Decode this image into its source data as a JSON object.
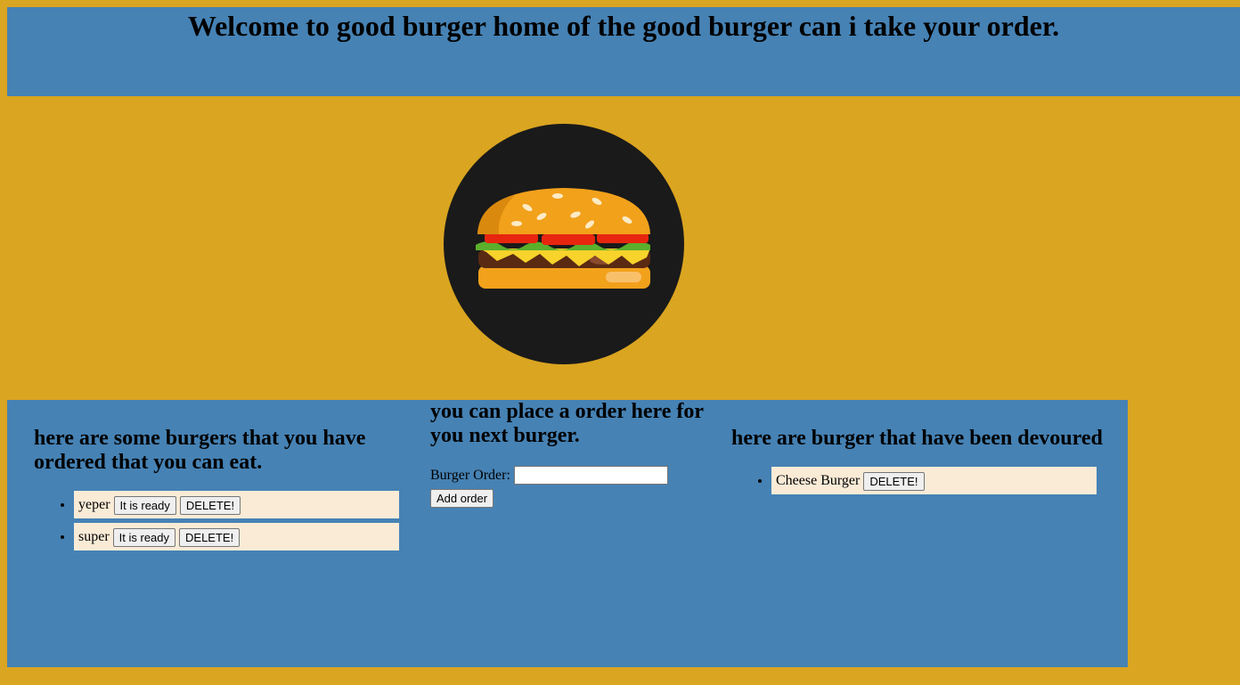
{
  "header": {
    "title": "Welcome to good burger home of the good burger can i take your order."
  },
  "logo": {
    "icon": "burger-icon",
    "colors": {
      "circle": "#1a1a1a",
      "bun": "#F2A11B",
      "tomato": "#E8260F",
      "lettuce": "#5BAF2A",
      "cheese": "#F7D32B",
      "patty": "#5A2A12"
    }
  },
  "ordered": {
    "heading": "here are some burgers that you have ordered that you can eat.",
    "items": [
      {
        "name": "yeper",
        "ready_label": "It is ready",
        "delete_label": "DELETE!"
      },
      {
        "name": "super",
        "ready_label": "It is ready",
        "delete_label": "DELETE!"
      }
    ]
  },
  "order_form": {
    "heading": "you can place a order here for you next burger.",
    "label": "Burger Order:",
    "value": "",
    "button_label": "Add order"
  },
  "devoured": {
    "heading": "here are burger that have been devoured",
    "items": [
      {
        "name": "Cheese Burger",
        "delete_label": "DELETE!"
      }
    ]
  },
  "colors": {
    "background": "#DAA520",
    "panel": "#4682B4",
    "list_item": "#FAEBD7"
  }
}
